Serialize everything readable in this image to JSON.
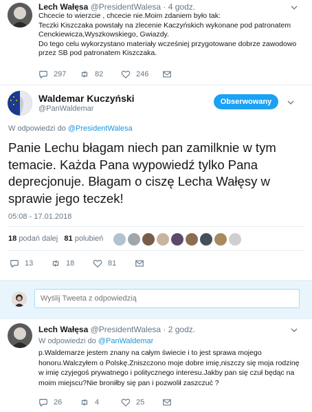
{
  "tweet1": {
    "name": "Lech Wałęsa",
    "handle": "@PresidentWalesa",
    "time": "· 4 godz.",
    "text_lines": [
      "Chcecie to wierzcie , chcecie nie.Moim zdaniem było tak:",
      "Teczki Kiszczaka powstały na zlecenie Kaczyńskich wykonane pod patronatem",
      "Cenckiewicza,Wyszkowskiego, Gwiazdy.",
      "Do tego celu wykorzystano materiały wcześniej przygotowane dobrze zawodowo",
      "przez SB pod patronatem Kiszczaka."
    ],
    "replies": "297",
    "retweets": "82",
    "likes": "246"
  },
  "main_tweet": {
    "name": "Waldemar Kuczyński",
    "handle": "@PanWaldemar",
    "follow_label": "Obserwowany",
    "reply_to_prefix": "W odpowiedzi do",
    "reply_to_handle": "@PresidentWalesa",
    "text": "Panie Lechu błagam niech pan zamilknie w tym temacie. Każda Pana wypowiedź tylko Pana deprecjonuje. Błagam o ciszę Lecha Wałęsy w sprawie jego teczek!",
    "timestamp": "05:08 - 17.01.2018",
    "retweets_count": "18",
    "retweets_label": "podań dalej",
    "likes_count": "81",
    "likes_label": "polubień",
    "replies": "13",
    "retweets": "18",
    "likes": "81"
  },
  "reply_box": {
    "placeholder": "Wyślij Tweeta z odpowiedzią"
  },
  "tweet3": {
    "name": "Lech Wałęsa",
    "handle": "@PresidentWalesa",
    "time": "· 2 godz.",
    "reply_to_prefix": "W odpowiedzi do",
    "reply_to_handle": "@PanWaldemar",
    "text_lines": [
      "p.Waldemarze jestem znany na całym świecie i to jest sprawa mojego",
      "honoru.Walczyłem o Polskę.Zniszczono moje dobre imię,niszczy się moja rodzinę",
      "w imię  czyjegoś prywatnego i politycznego interesu.Jakby pan się czuł będąc na",
      "moim miejscu?Nie broniłby się pan i pozwolił zaszczuć ?"
    ],
    "replies": "26",
    "retweets": "4",
    "likes": "25"
  },
  "colors": {
    "accent": "#1da1f2",
    "link": "#1b95e0",
    "muted": "#657786",
    "follow_bg": "#1da1f2"
  }
}
